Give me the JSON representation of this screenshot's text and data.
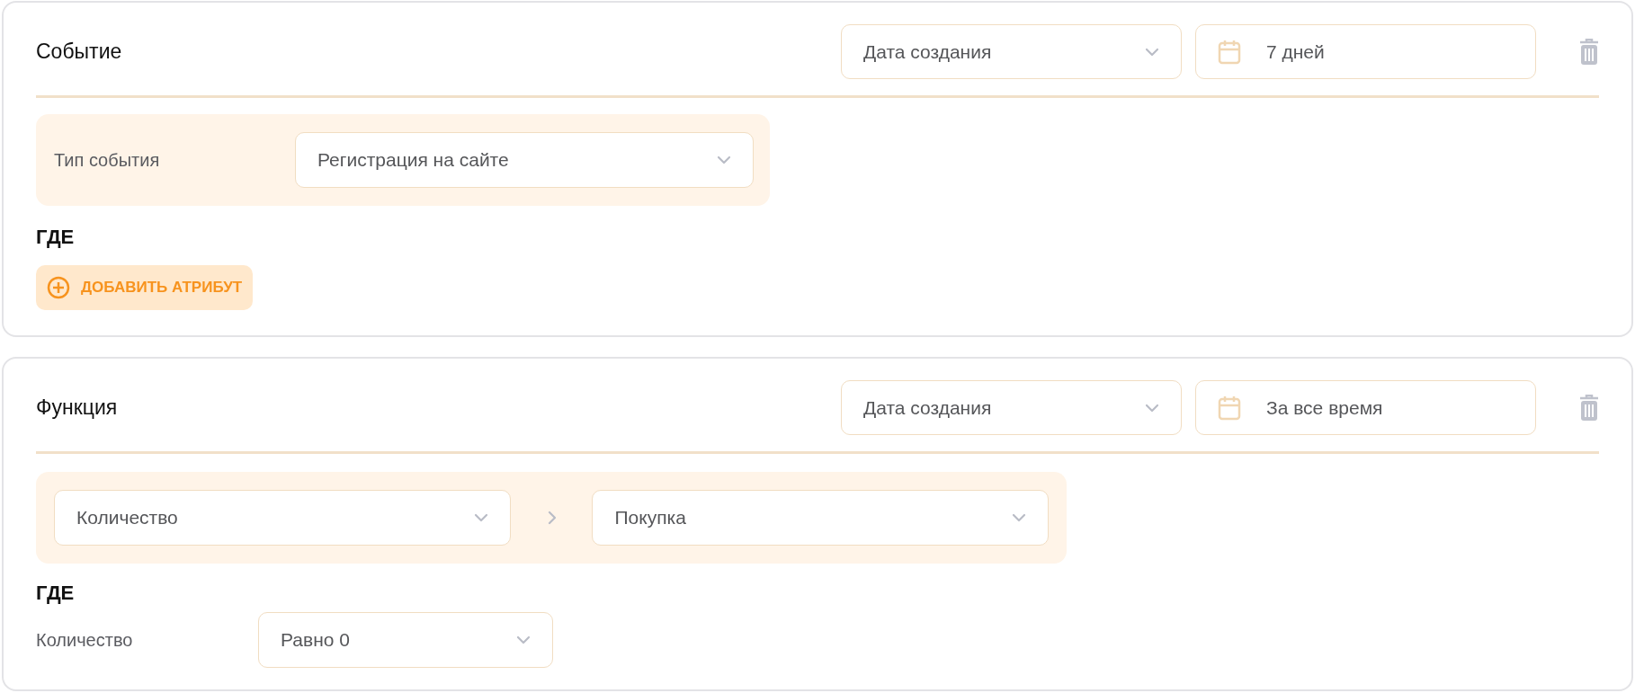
{
  "cards": [
    {
      "kind": "event",
      "title": "Событие",
      "date_field": "Дата создания",
      "period": "7 дней",
      "condition": {
        "label": "Тип события",
        "value": "Регистрация на сайте"
      },
      "where": {
        "heading": "ГДЕ",
        "add_button": "ДОБАВИТЬ АТРИБУТ"
      }
    },
    {
      "kind": "function",
      "title": "Функция",
      "date_field": "Дата создания",
      "period": "За все время",
      "function": {
        "operation": "Количество",
        "target": "Покупка"
      },
      "where": {
        "heading": "ГДЕ",
        "rows": [
          {
            "label": "Количество",
            "value": "Равно 0"
          }
        ]
      }
    }
  ]
}
